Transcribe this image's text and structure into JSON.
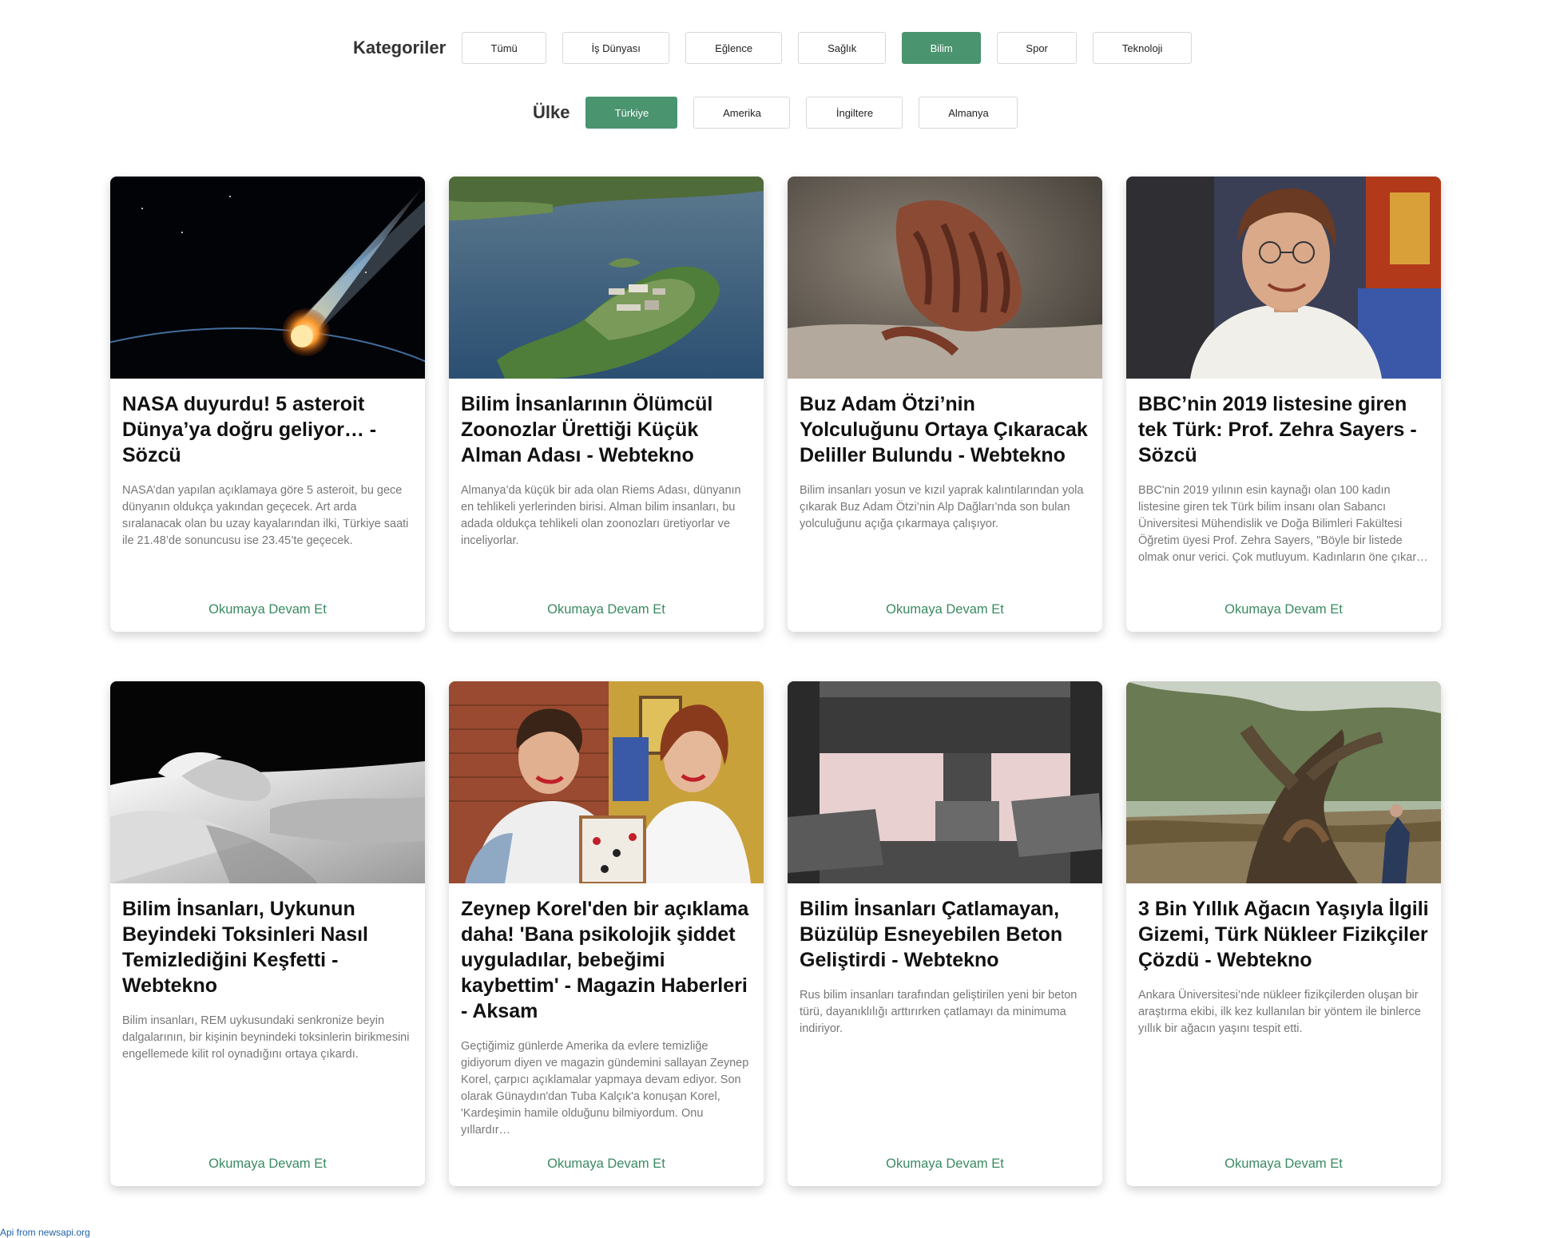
{
  "filters": {
    "categories_label": "Kategoriler",
    "categories": [
      "Tümü",
      "İş Dünyası",
      "Eğlence",
      "Sağlık",
      "Bilim",
      "Spor",
      "Teknoloji"
    ],
    "categories_active": "Bilim",
    "country_label": "Ülke",
    "countries": [
      "Türkiye",
      "Amerika",
      "İngiltere",
      "Almanya"
    ],
    "countries_active": "Türkiye"
  },
  "colors": {
    "accent": "#4a9470",
    "link": "#3a8a62",
    "footer_link": "#2264a8"
  },
  "read_more_label": "Okumaya Devam Et",
  "articles": [
    {
      "title": "NASA duyurdu! 5 asteroit Dünya’ya doğru geliyor… - Sözcü",
      "description": "NASA’dan yapılan açıklamaya göre 5 asteroit, bu gece dünyanın oldukça yakından geçecek. Art arda sıralanacak olan bu uzay kayalarından ilki, Türkiye saati ile 21.48’de sonuncusu ise 23.45’te geçecek.",
      "image": "meteor-image"
    },
    {
      "title": "Bilim İnsanlarının Ölümcül Zoonozlar Ürettiği Küçük Alman Adası - Webtekno",
      "description": "Almanya’da küçük bir ada olan Riems Adası, dünyanın en tehlikeli yerlerinden birisi. Alman bilim insanları, bu adada oldukça tehlikeli olan zoonozları üretiyorlar ve inceliyorlar.",
      "image": "island-image"
    },
    {
      "title": "Buz Adam Ötzi’nin Yolculuğunu Ortaya Çıkaracak Deliller Bulundu - Webtekno",
      "description": "Bilim insanları yosun ve kızıl yaprak kalıntılarından yola çıkarak Buz Adam Ötzi’nin Alp Dağları’nda son bulan yolculuğunu açığa çıkarmaya çalışıyor.",
      "image": "mummy-hand-image"
    },
    {
      "title": "BBC’nin 2019 listesine giren tek Türk: Prof. Zehra Sayers - Sözcü",
      "description": "BBC'nin 2019 yılının esin kaynağı olan 100 kadın listesine giren tek Türk bilim insanı olan Sabancı Üniversitesi Mühendislik ve Doğa Bilimleri Fakültesi Öğretim üyesi Prof. Zehra Sayers, \"Böyle bir listede olmak onur verici. Çok mutluyum. Kadınların öne çıkar…",
      "image": "portrait-image"
    },
    {
      "title": "Bilim İnsanları, Uykunun Beyindeki Toksinleri Nasıl Temizlediğini Keşfetti - Webtekno",
      "description": "Bilim insanları, REM uykusundaki senkronize beyin dalgalarının, bir kişinin beynindeki toksinlerin birikmesini engellemede kilit rol oynadığını ortaya çıkardı.",
      "image": "sleeping-woman-image"
    },
    {
      "title": "Zeynep Korel'den bir açıklama daha! 'Bana psikolojik şiddet uyguladılar, bebeğimi kaybettim' - Magazin Haberleri - Aksam",
      "description": "Geçtiğimiz günlerde Amerika da evlere temizliğe gidiyorum diyen ve magazin gündemini sallayan Zeynep Korel, çarpıcı açıklamalar yapmaya devam ediyor. Son olarak Günaydın'dan Tuba Kalçık'a konuşan Korel, 'Kardeşimin hamile olduğunu bilmiyordum. Onu yıllardır…",
      "image": "two-women-image"
    },
    {
      "title": "Bilim İnsanları Çatlamayan, Büzülüp Esneyebilen Beton Geliştirdi - Webtekno",
      "description": "Rus bilim insanları tarafından geliştirilen yeni bir beton türü, dayanıklılığı arttırırken çatlamayı da minimuma indiriyor.",
      "image": "press-machine-image"
    },
    {
      "title": "3 Bin Yıllık Ağacın Yaşıyla İlgili Gizemi, Türk Nükleer Fizikçiler Çözdü - Webtekno",
      "description": "Ankara Üniversitesi’nde nükleer fizikçilerden oluşan bir araştırma ekibi, ilk kez kullanılan bir yöntem ile binlerce yıllık bir ağacın yaşını tespit etti.",
      "image": "olive-tree-image"
    }
  ],
  "footer": {
    "api_credit": "Api from newsapi.org"
  }
}
